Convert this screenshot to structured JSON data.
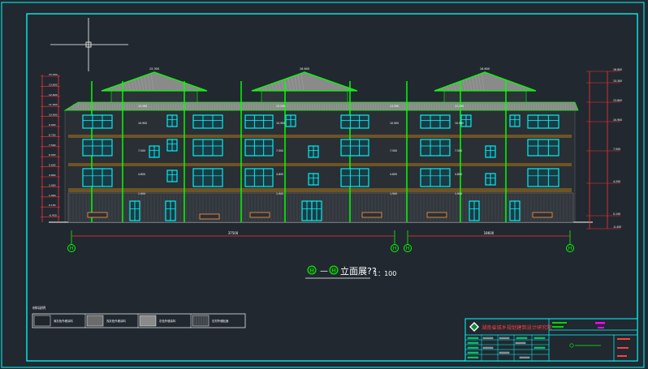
{
  "drawing": {
    "title_marker": "H",
    "title_dash": "—",
    "title_marker2": "H",
    "title_text": "立面展??",
    "scale": "1：100",
    "legend_header": "材料说明",
    "legend_items": [
      {
        "label": "深灰色外墙涂料",
        "fill": "#1f2529"
      },
      {
        "label": "浅灰色外墙涂料",
        "fill": "#6b6b6b"
      },
      {
        "label": "灰色外墙涂料",
        "fill": "#8a8a8a"
      },
      {
        "label": "石材外墙贴面",
        "fill": "#3a3f44"
      }
    ],
    "title_block_org": "湖南省城乡规划建筑设计研究院",
    "total_dim_left": "37500",
    "total_dim_right": "18600",
    "axis_labels": [
      "H",
      "H",
      "H",
      "H"
    ],
    "left_elevations": [
      "15.300",
      "13.800",
      "12.600",
      "11.900",
      "10.900",
      "9.000",
      "8.700",
      "7.500",
      "6.000",
      "5.600",
      "4.800",
      "3.900",
      "1.900",
      "0.150",
      "-0.450"
    ],
    "right_elevations": [
      "16.600",
      "15.300",
      "13.800",
      "10.900",
      "7.500",
      "4.200",
      "0.150",
      "-0.450"
    ],
    "roof_peaks": [
      "15.300",
      "16.600",
      "16.600"
    ],
    "floor_levels": [
      "13.290",
      "10.900",
      "7.500",
      "4.800",
      "1.900"
    ],
    "colors": {
      "background": "#212830",
      "frame": "#00ffff",
      "roof_green": "#00ff00",
      "windows": "#00ffff",
      "wall": "#2a2f35",
      "band_brown": "#7a5a22",
      "dims_red": "#ff3030"
    }
  }
}
